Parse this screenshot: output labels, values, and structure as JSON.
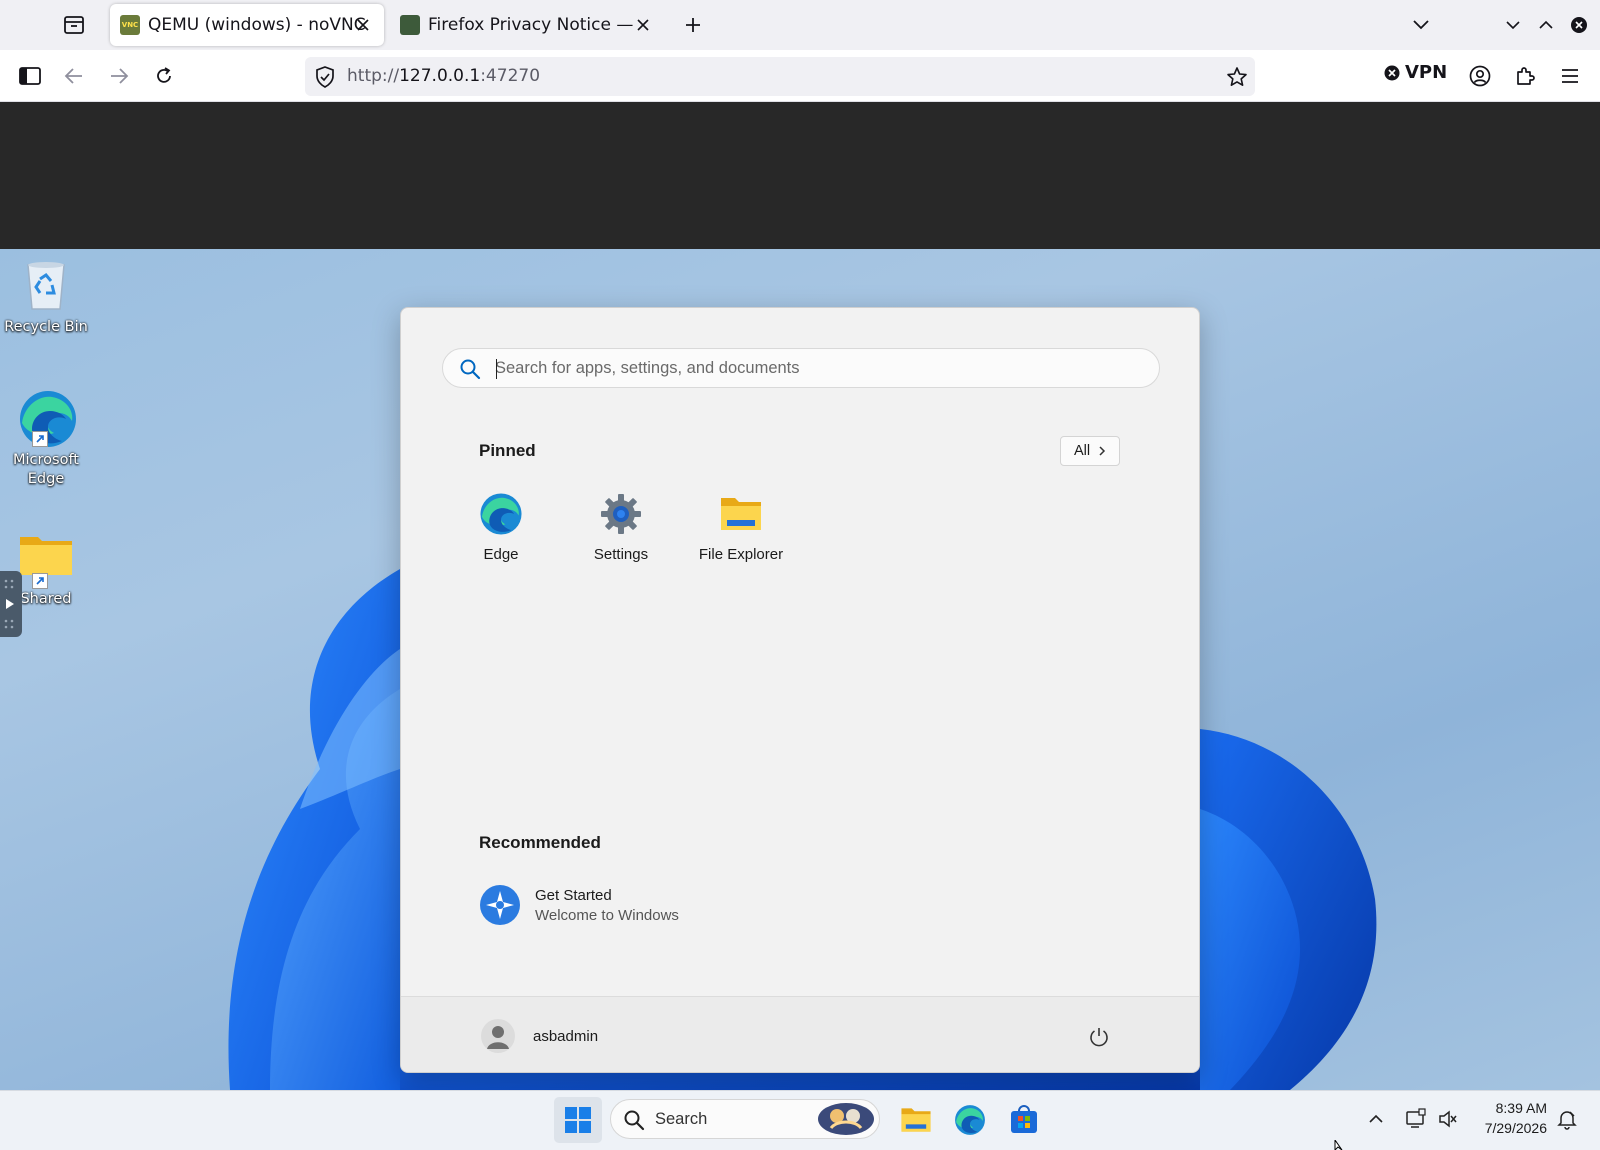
{
  "browser": {
    "tabs": [
      {
        "title": "QEMU (windows) - noVNC",
        "favicon_text": "VNC",
        "active": true
      },
      {
        "title": "Firefox Privacy Notice — M",
        "active": false
      }
    ],
    "url_scheme": "http://",
    "url_host": "127.0.0.1",
    "url_port": ":47270",
    "vpn_label": "VPN"
  },
  "desktop": {
    "icons": [
      {
        "label": "Recycle Bin"
      },
      {
        "label": "Microsoft Edge"
      },
      {
        "label": "Shared"
      }
    ]
  },
  "start_menu": {
    "search_placeholder": "Search for apps, settings, and documents",
    "pinned_heading": "Pinned",
    "all_label": "All",
    "pinned": [
      {
        "label": "Edge",
        "icon": "edge-icon"
      },
      {
        "label": "Settings",
        "icon": "settings-gear-icon"
      },
      {
        "label": "File Explorer",
        "icon": "folder-icon"
      }
    ],
    "recommended_heading": "Recommended",
    "recommended": [
      {
        "title": "Get Started",
        "subtitle": "Welcome to Windows",
        "icon": "get-started-icon"
      }
    ],
    "user_name": "asbadmin"
  },
  "taskbar": {
    "search_label": "Search",
    "time": "8:39 AM",
    "date": "7/29/2026"
  },
  "colors": {
    "accent": "#0067c0",
    "vnc_bar": "#282828",
    "folder": "#f8c633"
  }
}
